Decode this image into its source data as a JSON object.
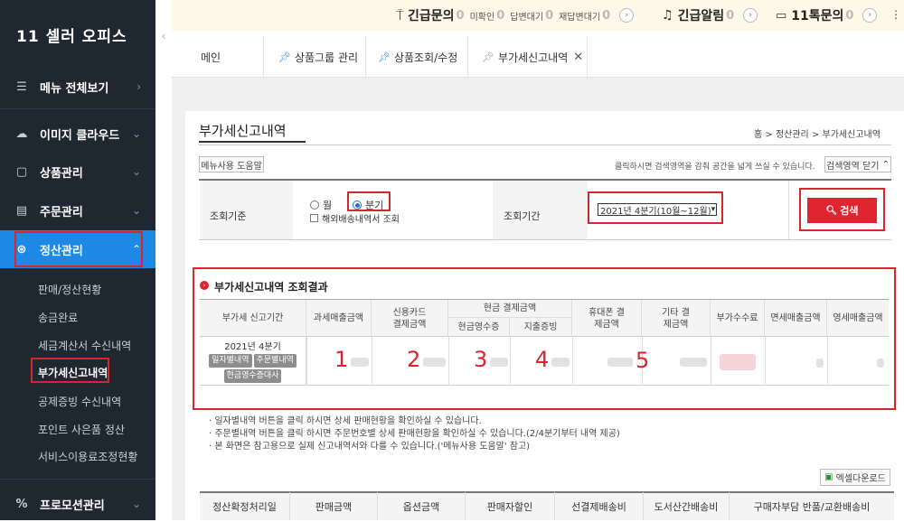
{
  "sidebar": {
    "logo": "11 셀러 오피스",
    "menu_all": "메뉴 전체보기",
    "items": [
      {
        "label": "이미지 클라우드",
        "icon": "cloud-icon"
      },
      {
        "label": "상품관리",
        "icon": "box-icon"
      },
      {
        "label": "주문관리",
        "icon": "list-icon"
      },
      {
        "label": "정산관리",
        "icon": "won-icon"
      }
    ],
    "sub_items": [
      "판매/정산현황",
      "송금완료",
      "세금계산서 수신내역",
      "부가세신고내역",
      "공제증빙 수신내역",
      "포인트 사은품 정산",
      "서비스이용료조정현황"
    ],
    "promo": "프로모션관리"
  },
  "topbar": {
    "urgent_inquiry": "긴급문의",
    "urgent_inquiry_count": "0",
    "unconfirmed": "미확인",
    "unconfirmed_count": "0",
    "pending": "답변대기",
    "pending_count": "0",
    "reanswer": "재답변대기",
    "reanswer_count": "0",
    "urgent_alert": "긴급알림",
    "urgent_alert_count": "0",
    "talk": "11톡문의",
    "talk_count": "0"
  },
  "tabs": [
    "메인",
    "상품그룹 관리",
    "상품조회/수정",
    "부가세신고내역"
  ],
  "page": {
    "title": "부가세신고내역",
    "breadcrumb": [
      "홈",
      "정산관리",
      "부가세신고내역"
    ],
    "help_button": "메뉴사용 도움말",
    "collapse_hint": "클릭하시면 검색영역을 감춰 공간을 넓게 쓰실 수 있습니다.",
    "collapse_button": "검색영역 닫기"
  },
  "search": {
    "criteria_label": "조회기준",
    "month": "월",
    "quarter": "분기",
    "overseas": "해외배송내역서 조회",
    "period_label": "조회기간",
    "period_value": "2021년 4분기(10월~12월)",
    "search_button": "검색"
  },
  "result": {
    "title": "부가세신고내역 조회결과",
    "headers": {
      "period": "부가세 신고기간",
      "taxable": "과세매출금액",
      "card": "신용카드 결제금액",
      "cash": "현금 결제금액",
      "cash_receipt": "현금영수증",
      "expense": "지출증빙",
      "mobile": "휴대폰 결제금액",
      "other": "기타 결제금액",
      "vat_fee": "부가수수료",
      "exempt": "면세매출금액",
      "zero": "영세매출금액"
    },
    "row": {
      "period": "2021년 4분기",
      "btn_daily": "일자별내역",
      "btn_order": "주문별내역",
      "btn_cash": "현금영수증대사"
    },
    "annotations": [
      "1",
      "2",
      "3",
      "4",
      "5"
    ]
  },
  "notes": [
    "· 일자별내역 버튼을 클릭 하시면 상세 판매현황을 확인하실 수 있습니다.",
    "· 주문별내역 버튼을 클릭 하시면 주문번호별 상세 판매현황을 확인하실 수 있습니다.(2/4분기부터 내역 제공)",
    "· 본 화면은 참고용으로 실제 신고내역서와 다를 수 있습니다.('메뉴사용 도움말' 참고)"
  ],
  "excel_button": "엑셀다운로드",
  "bottom_headers": [
    "정산확정처리일",
    "판매금액",
    "옵션금액",
    "판매자할인",
    "선결제배송비",
    "도서산간배송비",
    "구매자부담 반품/교환배송비"
  ]
}
